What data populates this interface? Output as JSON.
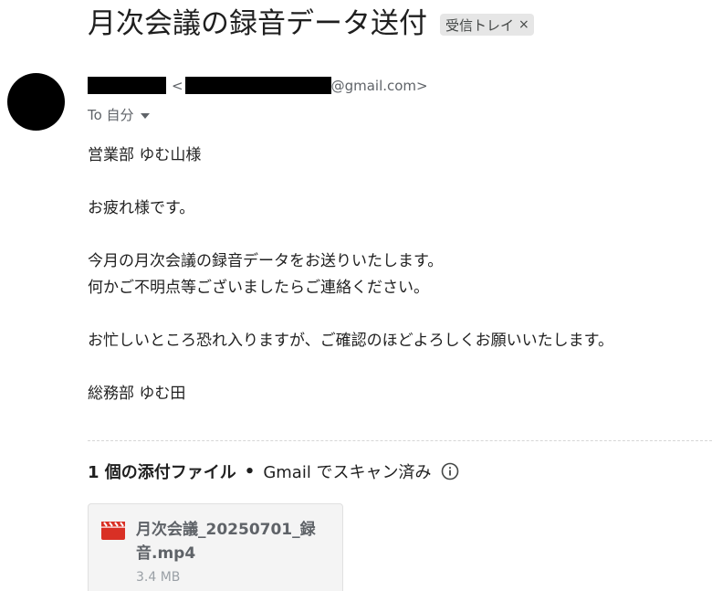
{
  "email": {
    "subject": "月次会議の録音データ送付",
    "label": "受信トレイ",
    "label_remove": "×",
    "sender": {
      "email_open": "<",
      "email_domain": "@gmail.com>"
    },
    "to": {
      "text": "To 自分"
    },
    "body": {
      "lines": [
        "営業部 ゆむ山様",
        "",
        "お疲れ様です。",
        "",
        "今月の月次会議の録音データをお送りいたします。",
        "何かご不明点等ございましたらご連絡ください。",
        "",
        "お忙しいところ恐れ入りますが、ご確認のほどよろしくお願いいたします。",
        "",
        "総務部 ゆむ田"
      ]
    },
    "attachments": {
      "count_label": "1 個の添付ファイル",
      "separator": "•",
      "scan_label": "Gmail でスキャン済み",
      "items": [
        {
          "name": "月次会議_20250701_録音.mp4",
          "size": "3.4 MB",
          "icon": "video-file-icon",
          "icon_color": "#d93025"
        }
      ]
    }
  }
}
